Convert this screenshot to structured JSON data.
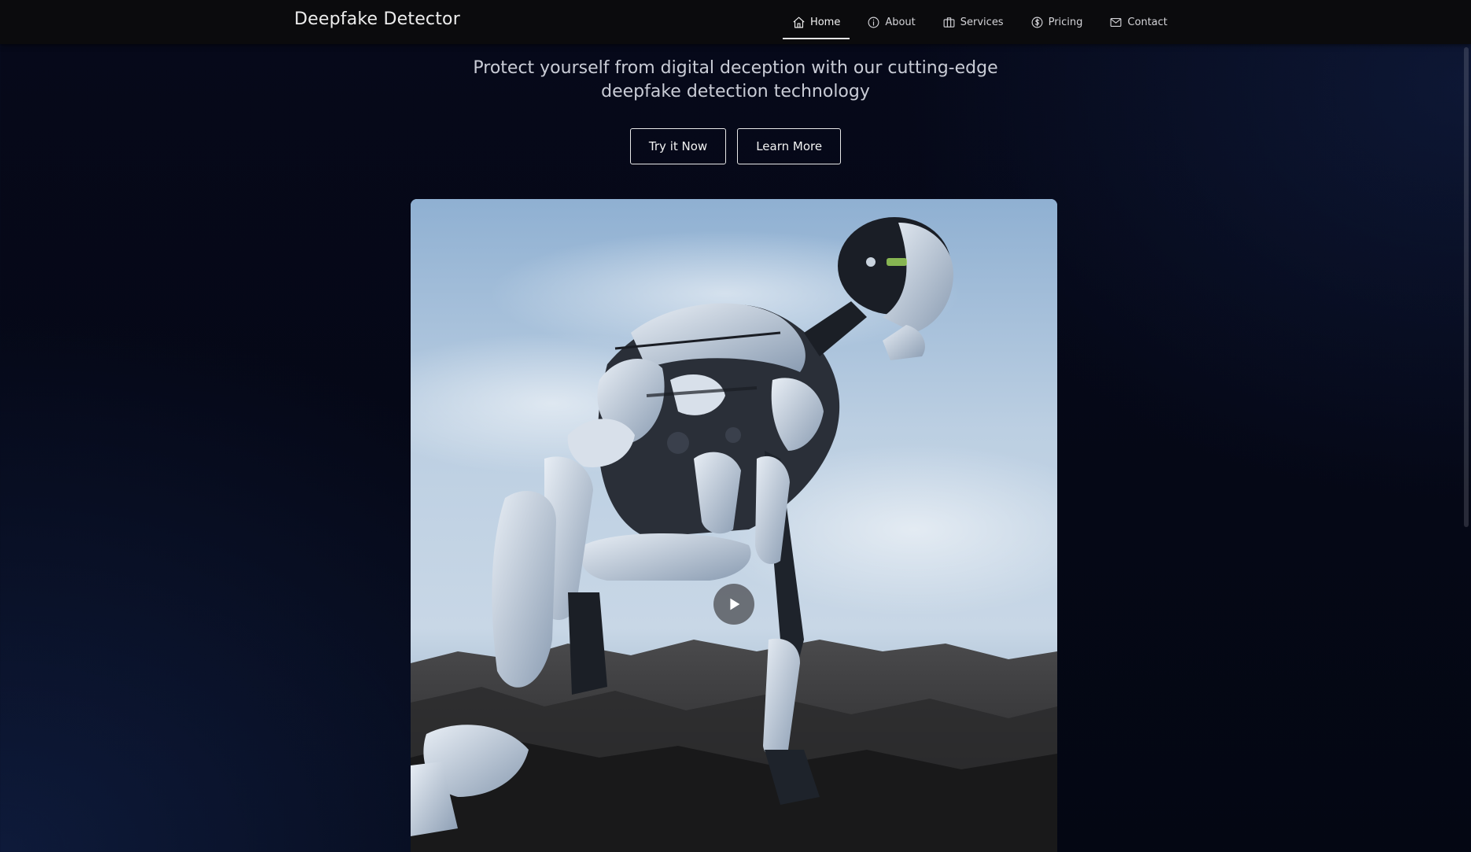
{
  "brand": "Deepfake Detector",
  "nav": {
    "items": [
      {
        "label": "Home",
        "icon": "home-icon",
        "active": true
      },
      {
        "label": "About",
        "icon": "info-icon",
        "active": false
      },
      {
        "label": "Services",
        "icon": "briefcase-icon",
        "active": false
      },
      {
        "label": "Pricing",
        "icon": "dollar-circle-icon",
        "active": false
      },
      {
        "label": "Contact",
        "icon": "mail-icon",
        "active": false
      }
    ]
  },
  "hero": {
    "subtitle_line1": "Protect yourself from digital deception with our cutting-edge",
    "subtitle_line2": "deepfake detection technology",
    "primary_button": "Try it Now",
    "secondary_button": "Learn More"
  },
  "video": {
    "subject": "robot crouching on rocks under a cloudy sky",
    "play_icon": "play-icon"
  },
  "colors": {
    "navbar_bg": "#0b0b0d",
    "page_bg": "#050816",
    "text": "#ededed"
  }
}
